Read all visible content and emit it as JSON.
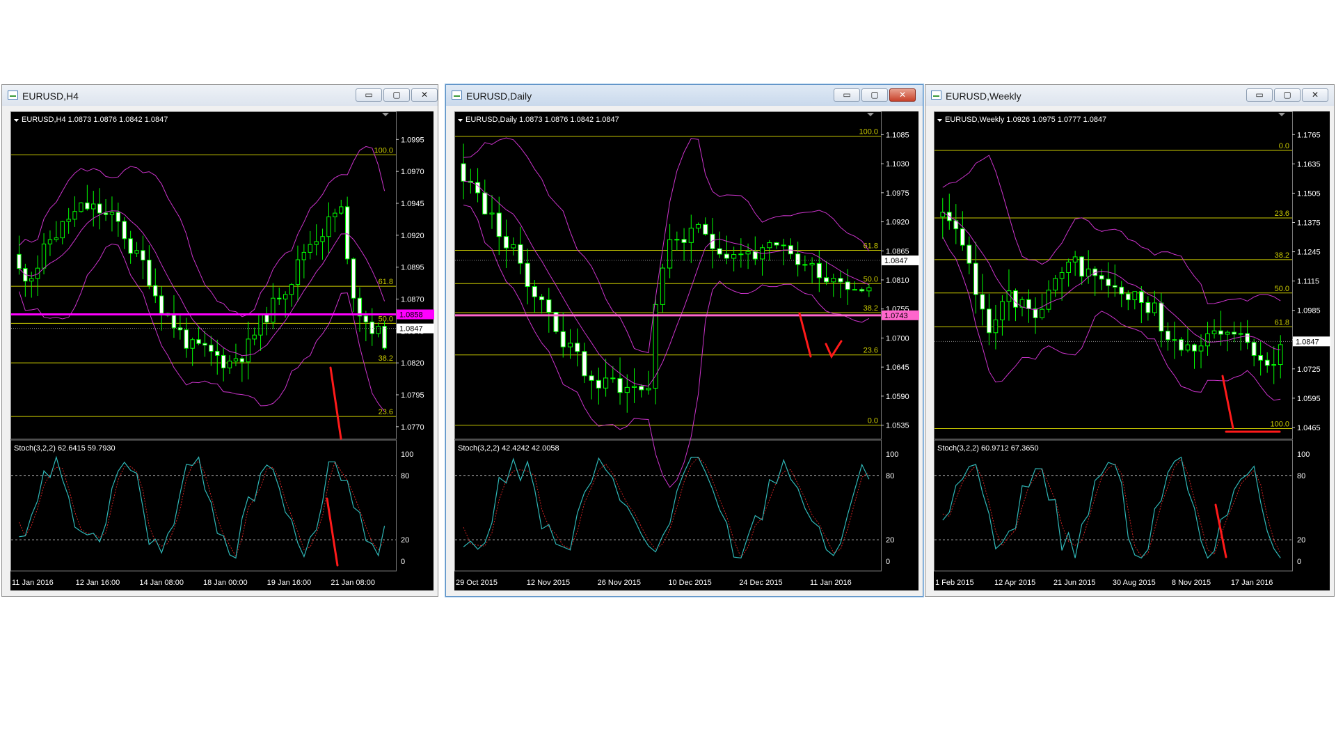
{
  "windows": [
    {
      "id": "h4",
      "title": "EURUSD,H4",
      "header": "EURUSD,H4  1.0873 1.0876 1.0842 1.0847",
      "price_labels": [
        "1.0995",
        "1.0970",
        "1.0945",
        "1.0920",
        "1.0895",
        "1.0870",
        "1.0845",
        "1.0820",
        "1.0795",
        "1.0770"
      ],
      "price_range": [
        1.0765,
        1.1005
      ],
      "current_price": "1.0847",
      "marker_price": "1.0858",
      "marker_color": "#ff00ff",
      "fib_levels": [
        {
          "label": "100.0",
          "price": 1.0983
        },
        {
          "label": "61.8",
          "price": 1.088
        },
        {
          "label": "50.0",
          "price": 1.0851
        },
        {
          "label": "38.2",
          "price": 1.082
        },
        {
          "label": "23.6",
          "price": 1.0778
        }
      ],
      "stoch_label": "Stoch(3,2,2) 62.6415 59.7930",
      "stoch_levels": [
        "100",
        "80",
        "20",
        "0"
      ],
      "x_labels": [
        "11 Jan 2016",
        "12 Jan 16:00",
        "14 Jan 08:00",
        "18 Jan 00:00",
        "19 Jan 16:00",
        "21 Jan 08:00"
      ]
    },
    {
      "id": "daily",
      "title": "EURUSD,Daily",
      "header": "EURUSD,Daily  1.0873 1.0876 1.0842 1.0847",
      "price_labels": [
        "1.1085",
        "1.1030",
        "1.0975",
        "1.0920",
        "1.0865",
        "1.0810",
        "1.0755",
        "1.0700",
        "1.0645",
        "1.0590",
        "1.0535"
      ],
      "price_range": [
        1.052,
        1.11
      ],
      "current_price": "1.0847",
      "marker_price": "1.0743",
      "marker_color": "#ff66cc",
      "fib_levels": [
        {
          "label": "100.0",
          "price": 1.1082
        },
        {
          "label": "61.8",
          "price": 1.0866
        },
        {
          "label": "50.0",
          "price": 1.0803
        },
        {
          "label": "38.2",
          "price": 1.0748
        },
        {
          "label": "23.6",
          "price": 1.0668
        },
        {
          "label": "0.0",
          "price": 1.0535
        }
      ],
      "stoch_label": "Stoch(3,2,2) 42.4242 42.0058",
      "stoch_levels": [
        "100",
        "80",
        "20",
        "0"
      ],
      "x_labels": [
        "29 Oct 2015",
        "12 Nov 2015",
        "26 Nov 2015",
        "10 Dec 2015",
        "24 Dec 2015",
        "11 Jan 2016"
      ]
    },
    {
      "id": "weekly",
      "title": "EURUSD,Weekly",
      "header": "EURUSD,Weekly  1.0926 1.0975 1.0777 1.0847",
      "price_labels": [
        "1.1765",
        "1.1635",
        "1.1505",
        "1.1375",
        "1.1245",
        "1.1115",
        "1.0985",
        "1.0855",
        "1.0725",
        "1.0595",
        "1.0465"
      ],
      "price_range": [
        1.044,
        1.18
      ],
      "current_price": "1.0847",
      "fib_levels": [
        {
          "label": "0.0",
          "price": 1.1695
        },
        {
          "label": "23.6",
          "price": 1.1395
        },
        {
          "label": "38.2",
          "price": 1.121
        },
        {
          "label": "50.0",
          "price": 1.1062
        },
        {
          "label": "61.8",
          "price": 1.0912
        },
        {
          "label": "100.0",
          "price": 1.046
        }
      ],
      "stoch_label": "Stoch(3,2,2) 60.9712 67.3650",
      "stoch_levels": [
        "100",
        "80",
        "20",
        "0"
      ],
      "x_labels": [
        "1 Feb 2015",
        "12 Apr 2015",
        "21 Jun 2015",
        "30 Aug 2015",
        "8 Nov 2015",
        "17 Jan 2016"
      ]
    }
  ],
  "buttons": {
    "minimize": "▭",
    "maximize": "▢",
    "close": "✕"
  },
  "colors": {
    "candle": "#00ff00",
    "bollinger": "#cc33cc",
    "fib": "#cccc00",
    "grid_text": "#ffffff",
    "stoch_main": "#2fb8b8",
    "stoch_signal": "#cc2222",
    "annotation": "#ff1a1a"
  }
}
